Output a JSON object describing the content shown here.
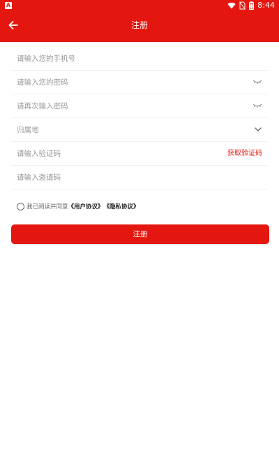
{
  "colors": {
    "brand": "#e3170f",
    "placeholder": "#9a9a9a",
    "divider": "#f0f0f0"
  },
  "status_bar": {
    "app_icon": "A",
    "time": "8:44",
    "icons": [
      "wifi-icon",
      "no-sim-icon",
      "battery-icon"
    ]
  },
  "header": {
    "back_icon": "arrow-left-icon",
    "title": "注册"
  },
  "form": {
    "phone_placeholder": "请输入您的手机号",
    "password_placeholder": "请输入您的密码",
    "confirm_password_placeholder": "请再次输入密码",
    "region_label": "归属地",
    "code_placeholder": "请输入验证码",
    "get_code_label": "获取验证码",
    "invite_placeholder": "请输入邀请码"
  },
  "agreement": {
    "prefix": "我已阅读并同意",
    "user_agreement": "《用户协议》",
    "privacy_agreement": "《隐私协议》"
  },
  "submit_label": "注册"
}
